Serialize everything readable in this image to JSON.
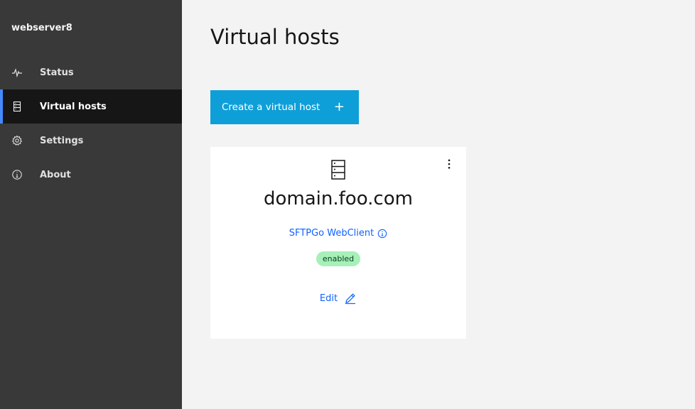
{
  "sidebar": {
    "app_title": "webserver8",
    "items": [
      {
        "label": "Status",
        "icon": "activity-icon"
      },
      {
        "label": "Virtual hosts",
        "icon": "server-icon",
        "active": true
      },
      {
        "label": "Settings",
        "icon": "gear-icon"
      },
      {
        "label": "About",
        "icon": "info-icon"
      }
    ]
  },
  "main": {
    "title": "Virtual hosts",
    "create_button_label": "Create a virtual host",
    "create_button_icon": "plus-icon",
    "card": {
      "icon": "server-icon",
      "hostname": "domain.foo.com",
      "link_label": "SFTPGo WebClient",
      "status": "enabled",
      "edit_label": "Edit"
    }
  },
  "colors": {
    "sidebar_bg": "#393939",
    "active_item_bg": "#161616",
    "accent": "#4589ff",
    "primary_button": "#0f9fd8",
    "link": "#0f62fe",
    "badge_bg": "#a7f0ba",
    "page_bg": "#f3f3f3"
  }
}
